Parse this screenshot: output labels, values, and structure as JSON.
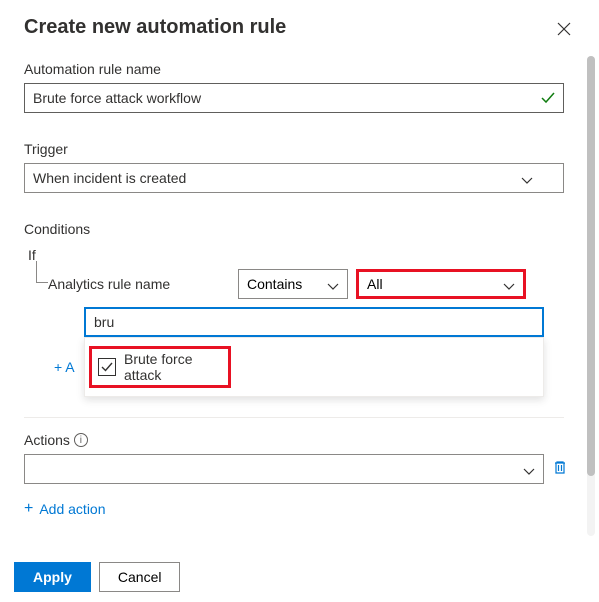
{
  "header": {
    "title": "Create new automation rule"
  },
  "ruleName": {
    "label": "Automation rule name",
    "value": "Brute force attack workflow"
  },
  "trigger": {
    "label": "Trigger",
    "selected": "When incident is created"
  },
  "conditions": {
    "title": "Conditions",
    "ifLabel": "If",
    "ruleNameLabel": "Analytics rule name",
    "operator": "Contains",
    "scope": "All",
    "searchValue": "bru",
    "dropdownOption": "Brute force attack",
    "addLabel": "+ A"
  },
  "actions": {
    "title": "Actions",
    "addAction": "Add action"
  },
  "footer": {
    "apply": "Apply",
    "cancel": "Cancel"
  }
}
